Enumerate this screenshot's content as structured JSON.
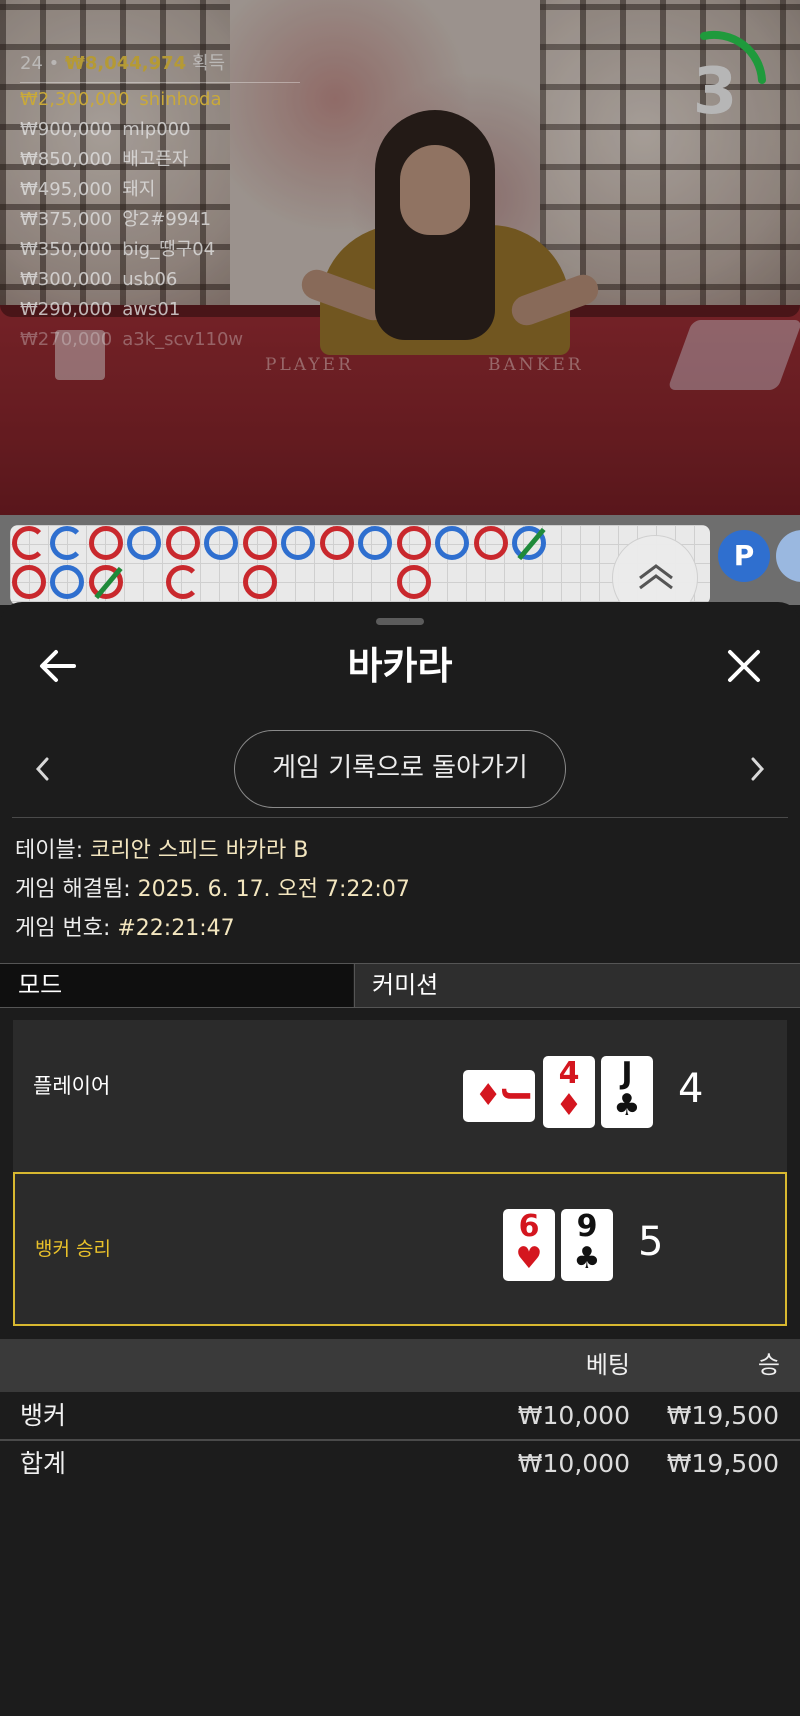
{
  "video": {
    "top_line_count": "24",
    "top_line_amount": "₩8,044,974",
    "top_line_suffix": "획득",
    "winners": [
      {
        "amount": "₩2,300,000",
        "name": "shinhoda"
      },
      {
        "amount": "₩900,000",
        "name": "mlp000"
      },
      {
        "amount": "₩850,000",
        "name": "배고픈자"
      },
      {
        "amount": "₩495,000",
        "name": "돼지"
      },
      {
        "amount": "₩375,000",
        "name": "앙2#9941"
      },
      {
        "amount": "₩350,000",
        "name": "big_땡구04"
      },
      {
        "amount": "₩300,000",
        "name": "usb06"
      },
      {
        "amount": "₩290,000",
        "name": "aws01"
      },
      {
        "amount": "₩270,000",
        "name": "a3k_scv110w"
      }
    ],
    "timer": "3",
    "felt_player": "PLAYER",
    "felt_banker": "BANKER",
    "timer_color": "#1f9a3c"
  },
  "roadmap": {
    "badge": "P",
    "banker_color": "#c9282d",
    "player_color": "#2f6fcf",
    "tie_color": "#1f8a3a"
  },
  "sheet": {
    "title": "바카라",
    "back_icon": "arrow-left-icon",
    "close_icon": "close-icon",
    "history_button": "게임 기록으로 돌아가기",
    "info": {
      "table_label": "테이블: ",
      "table_value": "코리안 스피드 바카라 B",
      "resolved_label": "게임 해결됨: ",
      "resolved_value": "2025. 6. 17. 오전 7:22:07",
      "number_label": "게임 번호: ",
      "number_value": "#22:21:47"
    },
    "mode_label": "모드",
    "commission_label": "커미션",
    "player": {
      "label": "플레이어",
      "score": "4",
      "cards": [
        {
          "rank": "J",
          "suit": "♦",
          "color": "red",
          "sideways": true
        },
        {
          "rank": "4",
          "suit": "♦",
          "color": "red",
          "sideways": false
        },
        {
          "rank": "J",
          "suit": "♣",
          "color": "black",
          "sideways": false
        }
      ]
    },
    "banker": {
      "label": "뱅커 승리",
      "score": "5",
      "cards": [
        {
          "rank": "6",
          "suit": "♥",
          "color": "red",
          "sideways": false
        },
        {
          "rank": "9",
          "suit": "♣",
          "color": "black",
          "sideways": false
        }
      ],
      "win_color": "#d8b830"
    },
    "bets": {
      "col_bet": "베팅",
      "col_win": "승",
      "rows": [
        {
          "name": "뱅커",
          "bet": "₩10,000",
          "win": "₩19,500"
        },
        {
          "name": "합계",
          "bet": "₩10,000",
          "win": "₩19,500"
        }
      ]
    }
  }
}
